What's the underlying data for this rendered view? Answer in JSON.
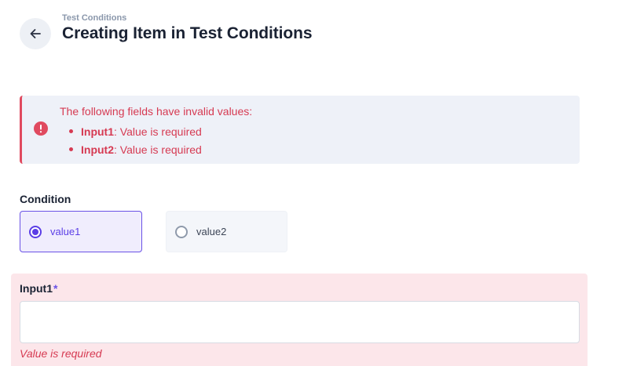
{
  "header": {
    "breadcrumb": "Test Conditions",
    "title": "Creating Item in Test Conditions",
    "back_icon": "arrow-left-icon"
  },
  "alert": {
    "icon": "exclamation-circle-icon",
    "title": "The following fields have invalid values:",
    "items": [
      {
        "field": "Input1",
        "message": ": Value is required"
      },
      {
        "field": "Input2",
        "message": ": Value is required"
      }
    ],
    "color": "#d63a52"
  },
  "condition": {
    "label": "Condition",
    "options": [
      {
        "label": "value1",
        "selected": true
      },
      {
        "label": "value2",
        "selected": false
      }
    ],
    "accent": "#5b3ee6"
  },
  "input1": {
    "label": "Input1",
    "required_mark": "*",
    "value": "",
    "placeholder": "",
    "error": "Value is required"
  }
}
